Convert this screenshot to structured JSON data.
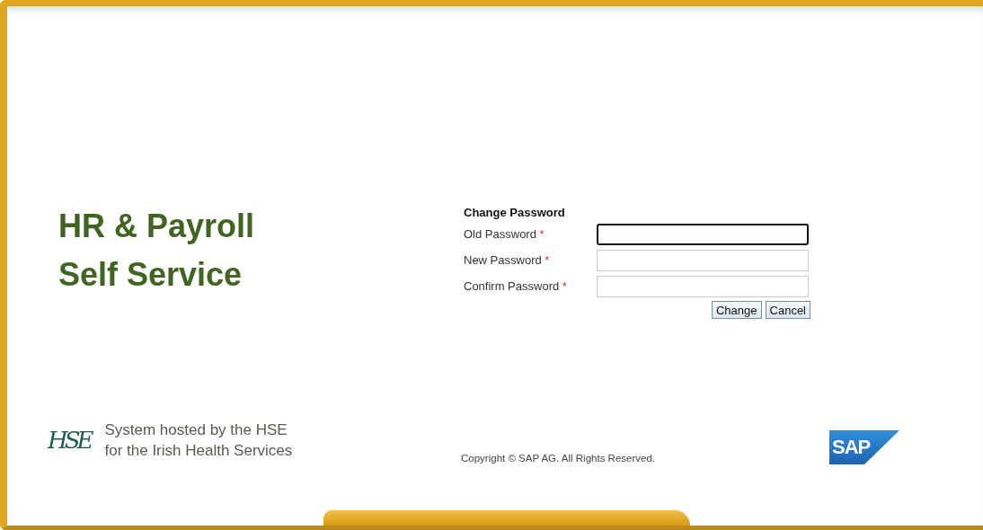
{
  "app_title": {
    "lines": [
      "HR & Payroll",
      "Self Service"
    ]
  },
  "form": {
    "title": "Change Password",
    "fields": [
      {
        "label": "Old Password",
        "required_mark": "*",
        "focused": true
      },
      {
        "label": "New Password",
        "required_mark": "*",
        "focused": false
      },
      {
        "label": "Confirm Password",
        "required_mark": "*",
        "focused": false
      }
    ],
    "buttons": [
      "Change",
      "Cancel"
    ]
  },
  "footer": {
    "hse_logo": "HSE",
    "hosted_lines": [
      "System hosted by the HSE",
      "for the Irish Health Services"
    ],
    "copyright": "Copyright © SAP AG. All Rights Reserved.",
    "sap_logo": "SAP"
  }
}
